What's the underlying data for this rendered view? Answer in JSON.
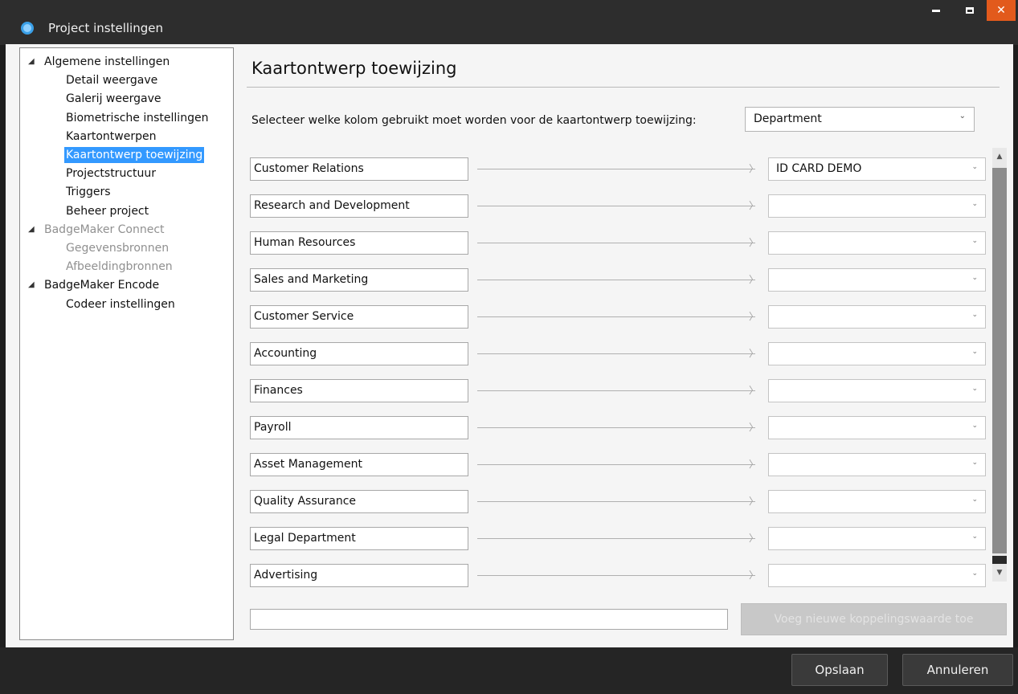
{
  "window": {
    "title": "Project instellingen",
    "accent_close": "#e25a1c"
  },
  "tree": {
    "items": [
      {
        "label": "Algemene instellingen",
        "level": 0,
        "expanded": true,
        "state": "normal"
      },
      {
        "label": "Detail weergave",
        "level": 1,
        "state": "normal"
      },
      {
        "label": "Galerij weergave",
        "level": 1,
        "state": "normal"
      },
      {
        "label": "Biometrische instellingen",
        "level": 1,
        "state": "normal"
      },
      {
        "label": "Kaartontwerpen",
        "level": 1,
        "state": "normal"
      },
      {
        "label": "Kaartontwerp toewijzing",
        "level": 1,
        "state": "selected"
      },
      {
        "label": "Projectstructuur",
        "level": 1,
        "state": "normal"
      },
      {
        "label": "Triggers",
        "level": 1,
        "state": "normal"
      },
      {
        "label": "Beheer project",
        "level": 1,
        "state": "normal"
      },
      {
        "label": "BadgeMaker Connect",
        "level": 0,
        "expanded": true,
        "state": "disabled"
      },
      {
        "label": "Gegevensbronnen",
        "level": 1,
        "state": "disabled"
      },
      {
        "label": "Afbeeldingbronnen",
        "level": 1,
        "state": "disabled"
      },
      {
        "label": "BadgeMaker Encode",
        "level": 0,
        "expanded": true,
        "state": "normal"
      },
      {
        "label": "Codeer instellingen",
        "level": 1,
        "state": "normal"
      }
    ],
    "selected_color": "#3399ff"
  },
  "main": {
    "title": "Kaartontwerp toewijzing",
    "prompt": "Selecteer welke kolom gebruikt moet worden voor de kaartontwerp toewijzing:",
    "column_select": {
      "value": "Department"
    },
    "mappings": [
      {
        "label": "Customer Relations",
        "design": "ID CARD DEMO"
      },
      {
        "label": "Research and Development",
        "design": ""
      },
      {
        "label": "Human Resources",
        "design": ""
      },
      {
        "label": "Sales and Marketing",
        "design": ""
      },
      {
        "label": "Customer Service",
        "design": ""
      },
      {
        "label": "Accounting",
        "design": ""
      },
      {
        "label": "Finances",
        "design": ""
      },
      {
        "label": "Payroll",
        "design": ""
      },
      {
        "label": "Asset Management",
        "design": ""
      },
      {
        "label": "Quality Assurance",
        "design": ""
      },
      {
        "label": "Legal Department",
        "design": ""
      },
      {
        "label": "Advertising",
        "design": ""
      }
    ],
    "new_value": {
      "value": "",
      "placeholder": ""
    },
    "add_button_label": "Voeg nieuwe koppelingswaarde toe"
  },
  "footer": {
    "save_label": "Opslaan",
    "cancel_label": "Annuleren"
  },
  "icons": {
    "tree_expand": "triangle-expanded-icon",
    "combo_chevron": "chevron-down-icon",
    "arrow": "arrow-right-icon"
  }
}
